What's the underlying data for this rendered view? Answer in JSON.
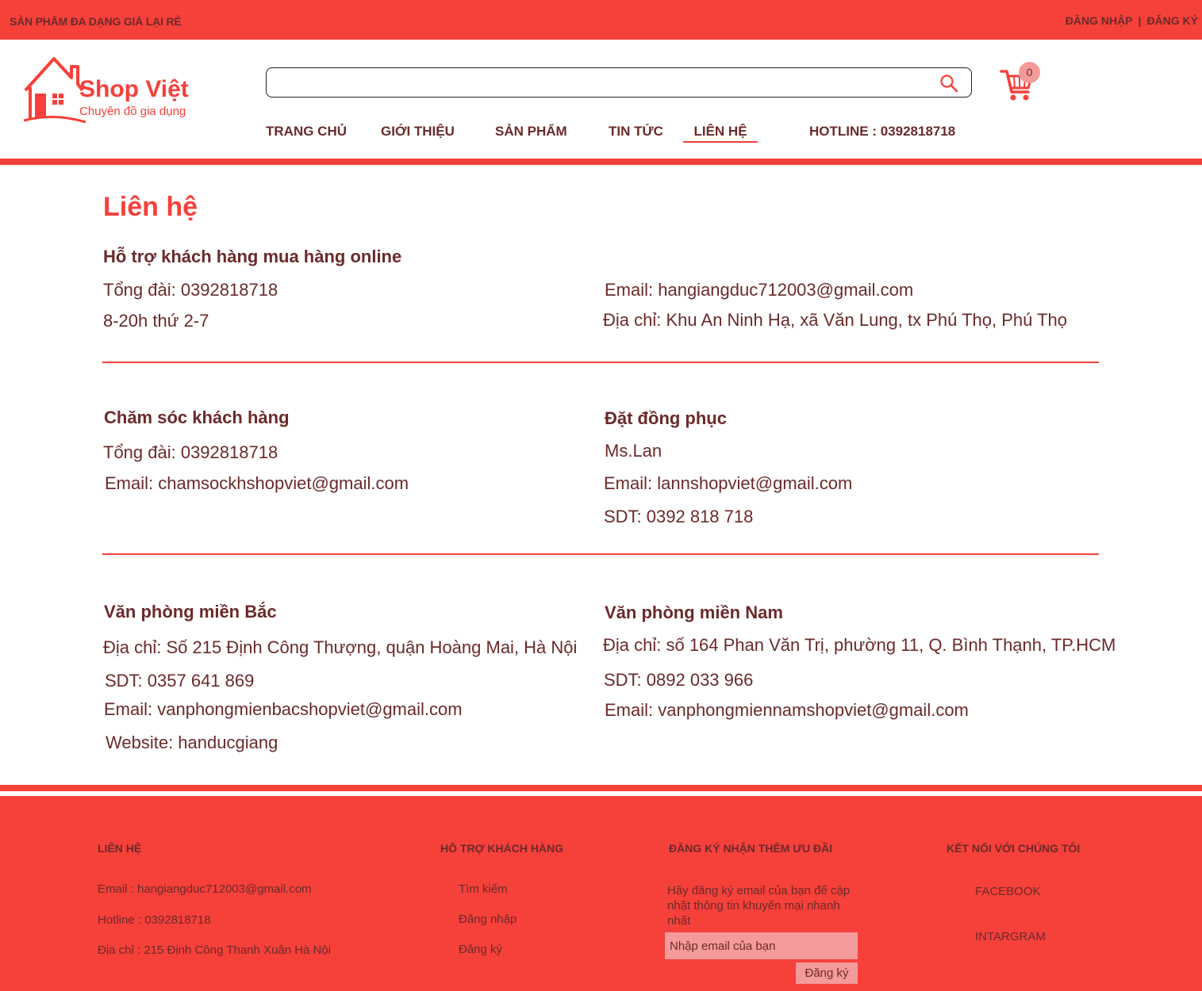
{
  "topbar": {
    "promo": "SẢN PHẨM ĐA DẠNG GIÁ LẠI RẺ",
    "login": "ĐĂNG NHẬP",
    "separator": "|",
    "register": "ĐĂNG KÝ"
  },
  "header": {
    "brand": "Shop Việt",
    "tagline": "Chuyên đồ gia dụng",
    "search_placeholder": "",
    "cart_count": "0"
  },
  "nav": {
    "items": [
      {
        "label": "TRANG CHỦ"
      },
      {
        "label": "GIỚI THIỆU"
      },
      {
        "label": "SẢN PHẨM"
      },
      {
        "label": "TIN TỨC"
      },
      {
        "label": "LIÊN HỆ"
      }
    ],
    "active": "LIÊN HỆ",
    "hotline": "HOTLINE : 0392818718"
  },
  "main": {
    "title": "Liên hệ",
    "online_support": {
      "title": "Hỗ trợ khách hàng mua hàng online",
      "phone": "Tổng đài: 0392818718",
      "hours": "8-20h thứ 2-7",
      "email": "Email: hangiangduc712003@gmail.com",
      "address": "Địa chỉ: Khu An Ninh Hạ, xã Văn Lung, tx Phú Thọ, Phú Thọ"
    },
    "customer_care": {
      "title": "Chăm sóc khách hàng",
      "phone": "Tổng đài: 0392818718",
      "email": "Email: chamsockhshopviet@gmail.com"
    },
    "uniform_order": {
      "title": "Đặt đồng phục",
      "contact": "Ms.Lan",
      "email": "Email: lannshopviet@gmail.com",
      "phone": "SDT: 0392 818 718"
    },
    "north_office": {
      "title": "Văn phòng miền Bắc",
      "address": "Địa chỉ: Số 215 Định Công Thượng, quận Hoàng Mai, Hà Nội",
      "phone": "SDT: 0357 641 869",
      "email": "Email: vanphongmienbacshopviet@gmail.com",
      "website": "Website: handucgiang"
    },
    "south_office": {
      "title": "Văn phòng miền Nam",
      "address": "Địa chỉ: số 164 Phan Văn Trị, phường 11, Q. Bình Thạnh, TP.HCM",
      "phone": "SDT: 0892 033 966",
      "email": "Email: vanphongmiennamshopviet@gmail.com"
    }
  },
  "footer": {
    "contact": {
      "title": "LIÊN HỆ",
      "email": "Email : hangiangduc712003@gmail.com",
      "hotline": "Hotline : 0392818718",
      "address": "Địa chỉ : 215 Định Công Thanh Xuân Hà Nội"
    },
    "support": {
      "title": "HỖ TRỢ KHÁCH HÀNG",
      "links": [
        "Tìm kiếm",
        "Đăng  nhập",
        "Đăng ký"
      ]
    },
    "newsletter": {
      "title": "ĐĂNG KÝ NHẬN THÊM ƯU ĐÃI",
      "description": "Hãy đăng ký email của bạn để cập nhật thông tin khuyến mại nhanh nhất",
      "placeholder": "Nhập email của bạn",
      "button": "Đăng ký"
    },
    "social": {
      "title": "KẾT NỐI VỚI CHÚNG TÔI",
      "links": [
        "FACEBOOK",
        "INTARGRAM"
      ]
    }
  },
  "colors": {
    "brand_red": "#f6403a",
    "text_dark": "#6b2a2a",
    "pink": "#f59a9a"
  },
  "icons": {
    "logo": "house-logo-icon",
    "search": "search-icon",
    "cart": "cart-icon"
  }
}
